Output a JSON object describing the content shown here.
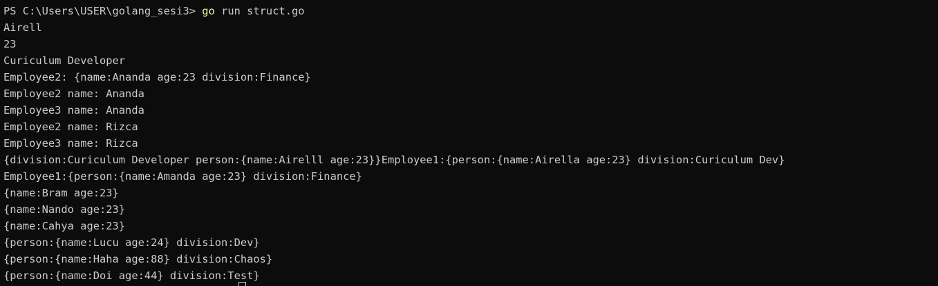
{
  "prompt": {
    "text": "PS C:\\Users\\USER\\golang_sesi3> ",
    "command_keyword": "go",
    "command_args": " run struct.go"
  },
  "output_lines": [
    "Airell",
    "23",
    "Curiculum Developer",
    "Employee2: {name:Ananda age:23 division:Finance}",
    "Employee2 name: Ananda",
    "Employee3 name: Ananda",
    "Employee2 name: Rizca",
    "Employee3 name: Rizca",
    "{division:Curiculum Developer person:{name:Airelll age:23}}Employee1:{person:{name:Airella age:23} division:Curiculum Dev}",
    "Employee1:{person:{name:Amanda age:23} division:Finance}",
    "{name:Bram age:23}",
    "{name:Nando age:23}",
    "{name:Cahya age:23}",
    "{person:{name:Lucu age:24} division:Dev}",
    "{person:{name:Haha age:88} division:Chaos}",
    "{person:{name:Doi age:44} division:Test}"
  ],
  "colors": {
    "background": "#0c0c0c",
    "foreground": "#cccccc",
    "command_highlight": "#f9f1a5"
  }
}
